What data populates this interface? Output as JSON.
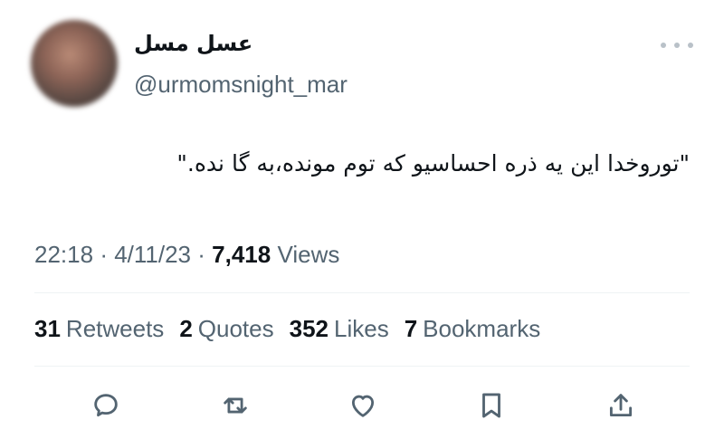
{
  "author": {
    "name": "عسل مسل",
    "handle": "@urmomsnight_mar"
  },
  "tweet": {
    "text": "\"توروخدا این یه ذره احساسیو که توم مونده،به گا نده.\""
  },
  "meta": {
    "time": "22:18",
    "date": "4/11/23",
    "views_count": "7,418",
    "views_label": "Views",
    "sep": "·"
  },
  "stats": {
    "retweets_count": "31",
    "retweets_label": "Retweets",
    "quotes_count": "2",
    "quotes_label": "Quotes",
    "likes_count": "352",
    "likes_label": "Likes",
    "bookmarks_count": "7",
    "bookmarks_label": "Bookmarks"
  },
  "icons": {
    "more": "more-icon",
    "reply": "reply-icon",
    "retweet": "retweet-icon",
    "like": "heart-icon",
    "bookmark": "bookmark-icon",
    "share": "share-icon"
  },
  "colors": {
    "text_primary": "#0f1419",
    "text_secondary": "#536471",
    "divider": "#eff3f4"
  }
}
